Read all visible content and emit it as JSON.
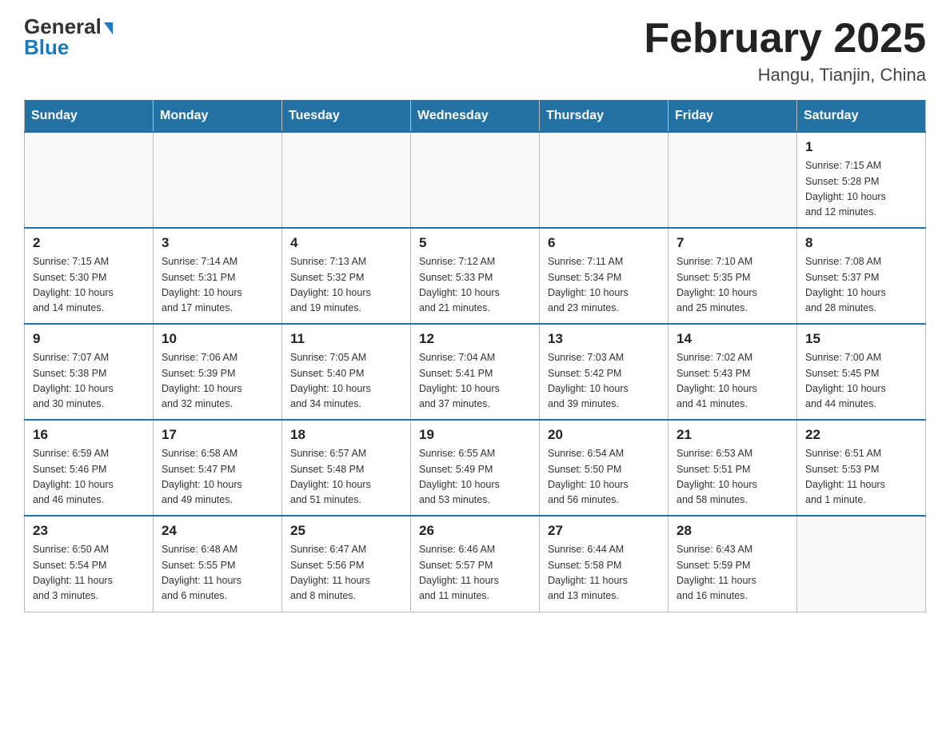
{
  "header": {
    "logo_line1": "General",
    "logo_line2": "Blue",
    "month_title": "February 2025",
    "location": "Hangu, Tianjin, China"
  },
  "weekdays": [
    "Sunday",
    "Monday",
    "Tuesday",
    "Wednesday",
    "Thursday",
    "Friday",
    "Saturday"
  ],
  "weeks": [
    [
      {
        "day": "",
        "info": ""
      },
      {
        "day": "",
        "info": ""
      },
      {
        "day": "",
        "info": ""
      },
      {
        "day": "",
        "info": ""
      },
      {
        "day": "",
        "info": ""
      },
      {
        "day": "",
        "info": ""
      },
      {
        "day": "1",
        "info": "Sunrise: 7:15 AM\nSunset: 5:28 PM\nDaylight: 10 hours\nand 12 minutes."
      }
    ],
    [
      {
        "day": "2",
        "info": "Sunrise: 7:15 AM\nSunset: 5:30 PM\nDaylight: 10 hours\nand 14 minutes."
      },
      {
        "day": "3",
        "info": "Sunrise: 7:14 AM\nSunset: 5:31 PM\nDaylight: 10 hours\nand 17 minutes."
      },
      {
        "day": "4",
        "info": "Sunrise: 7:13 AM\nSunset: 5:32 PM\nDaylight: 10 hours\nand 19 minutes."
      },
      {
        "day": "5",
        "info": "Sunrise: 7:12 AM\nSunset: 5:33 PM\nDaylight: 10 hours\nand 21 minutes."
      },
      {
        "day": "6",
        "info": "Sunrise: 7:11 AM\nSunset: 5:34 PM\nDaylight: 10 hours\nand 23 minutes."
      },
      {
        "day": "7",
        "info": "Sunrise: 7:10 AM\nSunset: 5:35 PM\nDaylight: 10 hours\nand 25 minutes."
      },
      {
        "day": "8",
        "info": "Sunrise: 7:08 AM\nSunset: 5:37 PM\nDaylight: 10 hours\nand 28 minutes."
      }
    ],
    [
      {
        "day": "9",
        "info": "Sunrise: 7:07 AM\nSunset: 5:38 PM\nDaylight: 10 hours\nand 30 minutes."
      },
      {
        "day": "10",
        "info": "Sunrise: 7:06 AM\nSunset: 5:39 PM\nDaylight: 10 hours\nand 32 minutes."
      },
      {
        "day": "11",
        "info": "Sunrise: 7:05 AM\nSunset: 5:40 PM\nDaylight: 10 hours\nand 34 minutes."
      },
      {
        "day": "12",
        "info": "Sunrise: 7:04 AM\nSunset: 5:41 PM\nDaylight: 10 hours\nand 37 minutes."
      },
      {
        "day": "13",
        "info": "Sunrise: 7:03 AM\nSunset: 5:42 PM\nDaylight: 10 hours\nand 39 minutes."
      },
      {
        "day": "14",
        "info": "Sunrise: 7:02 AM\nSunset: 5:43 PM\nDaylight: 10 hours\nand 41 minutes."
      },
      {
        "day": "15",
        "info": "Sunrise: 7:00 AM\nSunset: 5:45 PM\nDaylight: 10 hours\nand 44 minutes."
      }
    ],
    [
      {
        "day": "16",
        "info": "Sunrise: 6:59 AM\nSunset: 5:46 PM\nDaylight: 10 hours\nand 46 minutes."
      },
      {
        "day": "17",
        "info": "Sunrise: 6:58 AM\nSunset: 5:47 PM\nDaylight: 10 hours\nand 49 minutes."
      },
      {
        "day": "18",
        "info": "Sunrise: 6:57 AM\nSunset: 5:48 PM\nDaylight: 10 hours\nand 51 minutes."
      },
      {
        "day": "19",
        "info": "Sunrise: 6:55 AM\nSunset: 5:49 PM\nDaylight: 10 hours\nand 53 minutes."
      },
      {
        "day": "20",
        "info": "Sunrise: 6:54 AM\nSunset: 5:50 PM\nDaylight: 10 hours\nand 56 minutes."
      },
      {
        "day": "21",
        "info": "Sunrise: 6:53 AM\nSunset: 5:51 PM\nDaylight: 10 hours\nand 58 minutes."
      },
      {
        "day": "22",
        "info": "Sunrise: 6:51 AM\nSunset: 5:53 PM\nDaylight: 11 hours\nand 1 minute."
      }
    ],
    [
      {
        "day": "23",
        "info": "Sunrise: 6:50 AM\nSunset: 5:54 PM\nDaylight: 11 hours\nand 3 minutes."
      },
      {
        "day": "24",
        "info": "Sunrise: 6:48 AM\nSunset: 5:55 PM\nDaylight: 11 hours\nand 6 minutes."
      },
      {
        "day": "25",
        "info": "Sunrise: 6:47 AM\nSunset: 5:56 PM\nDaylight: 11 hours\nand 8 minutes."
      },
      {
        "day": "26",
        "info": "Sunrise: 6:46 AM\nSunset: 5:57 PM\nDaylight: 11 hours\nand 11 minutes."
      },
      {
        "day": "27",
        "info": "Sunrise: 6:44 AM\nSunset: 5:58 PM\nDaylight: 11 hours\nand 13 minutes."
      },
      {
        "day": "28",
        "info": "Sunrise: 6:43 AM\nSunset: 5:59 PM\nDaylight: 11 hours\nand 16 minutes."
      },
      {
        "day": "",
        "info": ""
      }
    ]
  ]
}
